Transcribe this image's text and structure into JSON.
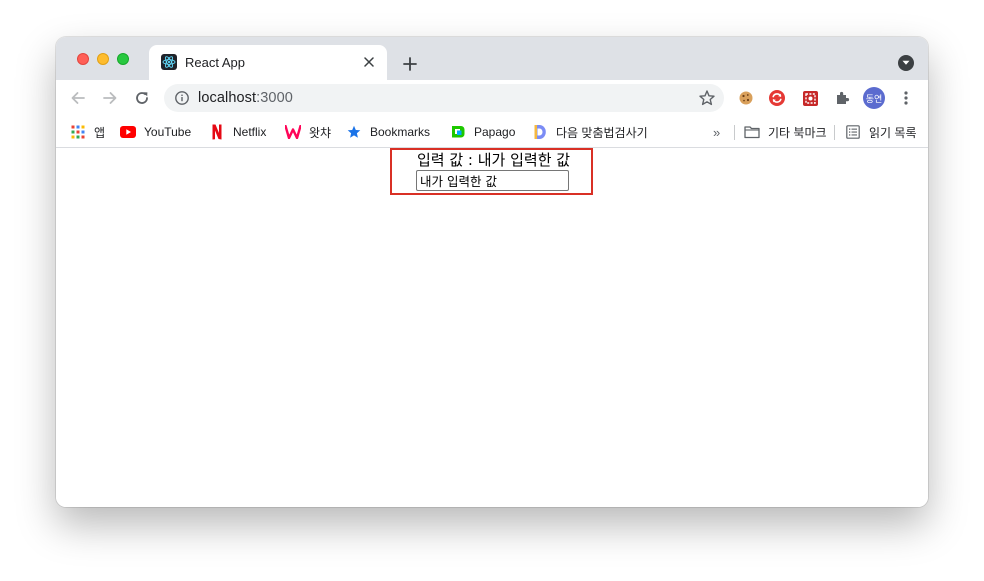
{
  "tab": {
    "title": "React App",
    "favicon": "react-logo-icon"
  },
  "toolbar": {
    "url_host": "localhost",
    "url_port": ":3000",
    "profile_initials": "동연"
  },
  "bookmarks": {
    "items": [
      {
        "label": "앱",
        "icon": "apps-grid-icon"
      },
      {
        "label": "YouTube",
        "icon": "youtube-icon"
      },
      {
        "label": "Netflix",
        "icon": "netflix-icon"
      },
      {
        "label": "왓챠",
        "icon": "watcha-icon"
      },
      {
        "label": "Bookmarks",
        "icon": "star-icon"
      },
      {
        "label": "Papago",
        "icon": "papago-icon"
      },
      {
        "label": "다음 맞춤법검사기",
        "icon": "daum-icon"
      }
    ],
    "overflow": "»",
    "other_bookmarks": "기타 북마크",
    "reading_list": "읽기 목록"
  },
  "page": {
    "output_text": "입력 값 : 내가 입력한 값",
    "input_value": "내가 입력한 값"
  },
  "colors": {
    "highlight_border": "#d93025",
    "tab_strip": "#dee1e6",
    "omnibox": "#f1f3f4",
    "avatar": "#5b6bcf"
  }
}
